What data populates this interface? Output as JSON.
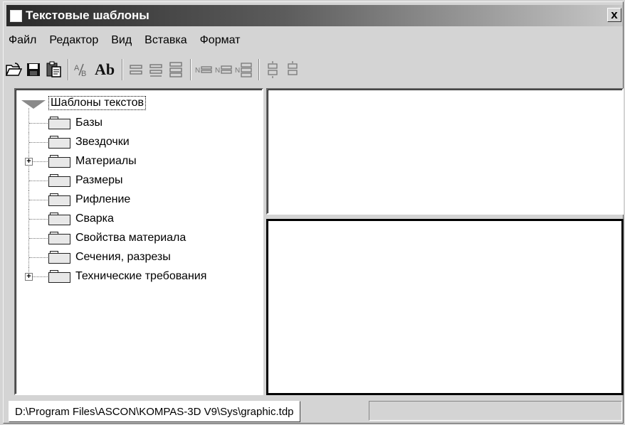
{
  "window": {
    "title": "Текстовые шаблоны",
    "close_glyph": "x"
  },
  "menu": {
    "items": [
      {
        "label": "Файл",
        "name": "menu-file"
      },
      {
        "label": "Редактор",
        "name": "menu-editor"
      },
      {
        "label": "Вид",
        "name": "menu-view"
      },
      {
        "label": "Вставка",
        "name": "menu-insert"
      },
      {
        "label": "Формат",
        "name": "menu-format"
      }
    ]
  },
  "toolbar": {
    "ab_label": "Ab",
    "icons": [
      "open-folder-icon",
      "save-icon",
      "paste-icon",
      "spell-check-icon",
      "font-ab-icon",
      "align-left-icon",
      "align-center-icon",
      "align-right-icon",
      "numbering-1-icon",
      "numbering-2-icon",
      "numbering-3-icon",
      "paragraph-icon-1",
      "paragraph-icon-2"
    ]
  },
  "tree": {
    "root_label": "Шаблоны текстов",
    "items": [
      {
        "label": "Базы",
        "expandable": false
      },
      {
        "label": "Звездочки",
        "expandable": false
      },
      {
        "label": "Материалы",
        "expandable": true
      },
      {
        "label": "Размеры",
        "expandable": false
      },
      {
        "label": "Рифление",
        "expandable": false
      },
      {
        "label": "Сварка",
        "expandable": false
      },
      {
        "label": "Свойства материала",
        "expandable": false
      },
      {
        "label": "Сечения, разрезы",
        "expandable": false
      },
      {
        "label": "Технические требования",
        "expandable": true
      }
    ],
    "expand_glyph": "+"
  },
  "status": {
    "path": "D:\\Program Files\\ASCON\\KOMPAS-3D V9\\Sys\\graphic.tdp"
  }
}
